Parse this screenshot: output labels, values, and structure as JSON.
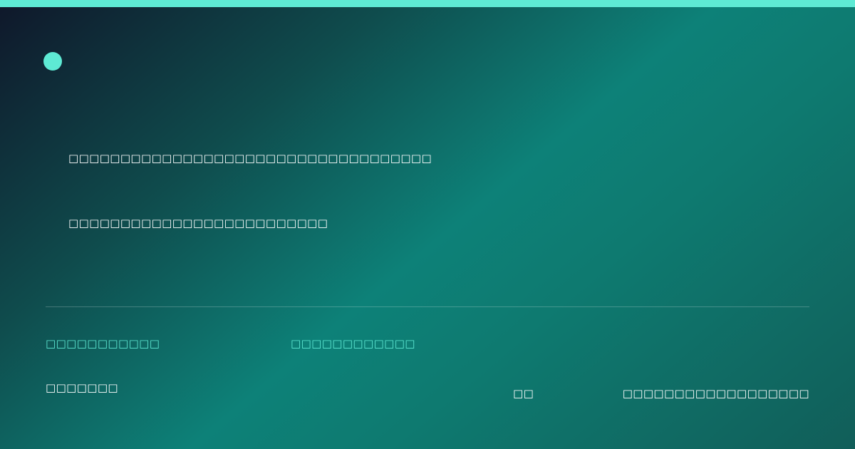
{
  "colors": {
    "accent": "#5eead4",
    "background_start": "#0f172a",
    "background_mid": "#0d8178",
    "background_end": "#115e59",
    "text": "#ffffff"
  },
  "icons": {
    "logo": "teal-dot-icon"
  },
  "hero": {
    "headline": "□□□□□□□□□□□□□□□□□□□□□□□□□□□□□□□□□□□",
    "subline": "□□□□□□□□□□□□□□□□□□□□□□□□□"
  },
  "footer": {
    "label_left": "□□□□□□□□□□□",
    "label_middle": "□□□□□□□□□□□□",
    "value_left": "□□□□□□□",
    "value_middle": "□□",
    "value_right": "□□□□□□□□□□□□□□□□□□"
  }
}
